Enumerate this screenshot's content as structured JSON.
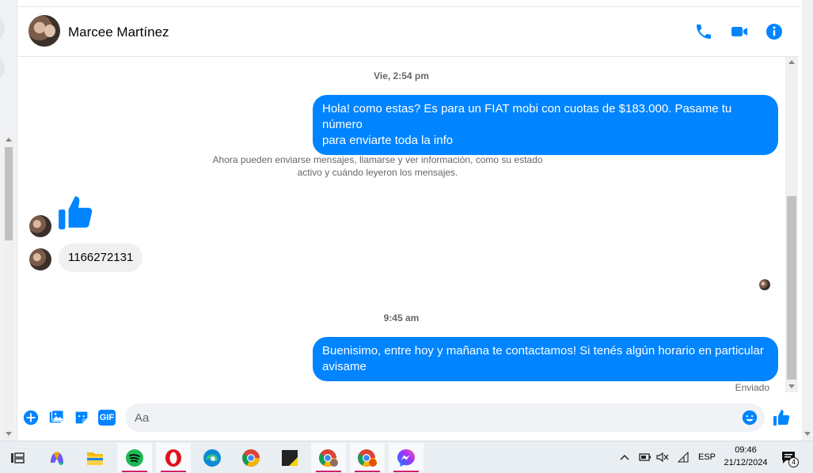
{
  "header": {
    "contact_name": "Marcee Martínez",
    "icons": [
      "phone-icon",
      "video-camera-icon",
      "info-icon"
    ]
  },
  "messages": [
    {
      "type": "timestamp",
      "text": "Vie, 2:54 pm"
    },
    {
      "type": "outgoing",
      "lines": [
        "Hola! como estas? Es para un FIAT mobi con cuotas de $183.000. Pasame tu número",
        "para enviarte toda la info"
      ]
    },
    {
      "type": "system",
      "lines": [
        "Ahora pueden enviarse mensajes, llamarse y ver información, como su estado",
        "activo y cuándo leyeron los mensajes."
      ]
    },
    {
      "type": "incoming-like",
      "icon": "thumbs-up-icon"
    },
    {
      "type": "incoming",
      "text": "1166272131"
    },
    {
      "type": "timestamp",
      "text": "9:45 am"
    },
    {
      "type": "outgoing",
      "lines": [
        "Buenisimo, entre hoy y mañana te contactamos! Si tenés algún horario en particular",
        "avisame"
      ]
    },
    {
      "type": "status",
      "text": "Enviado"
    }
  ],
  "composer": {
    "placeholder": "Aa",
    "icons": [
      "plus-icon",
      "image-icon",
      "sticker-icon",
      "gif-icon",
      "emoji-icon",
      "like-icon"
    ],
    "gif_label": "GIF"
  },
  "taskbar": {
    "apps": [
      "task-view-icon",
      "copilot-icon",
      "file-explorer-icon",
      "spotify-icon",
      "opera-icon",
      "edge-icon",
      "chrome-icon",
      "sticky-notes-icon",
      "chrome-profile-1-icon",
      "chrome-profile-2-icon",
      "messenger-icon"
    ],
    "language": "ESP",
    "time": "09:46",
    "date": "21/12/2024",
    "notification_count": "4"
  },
  "colors": {
    "accent": "#0084ff",
    "bubble_incoming": "#f0f0f0",
    "taskbar": "#e9eef3"
  }
}
